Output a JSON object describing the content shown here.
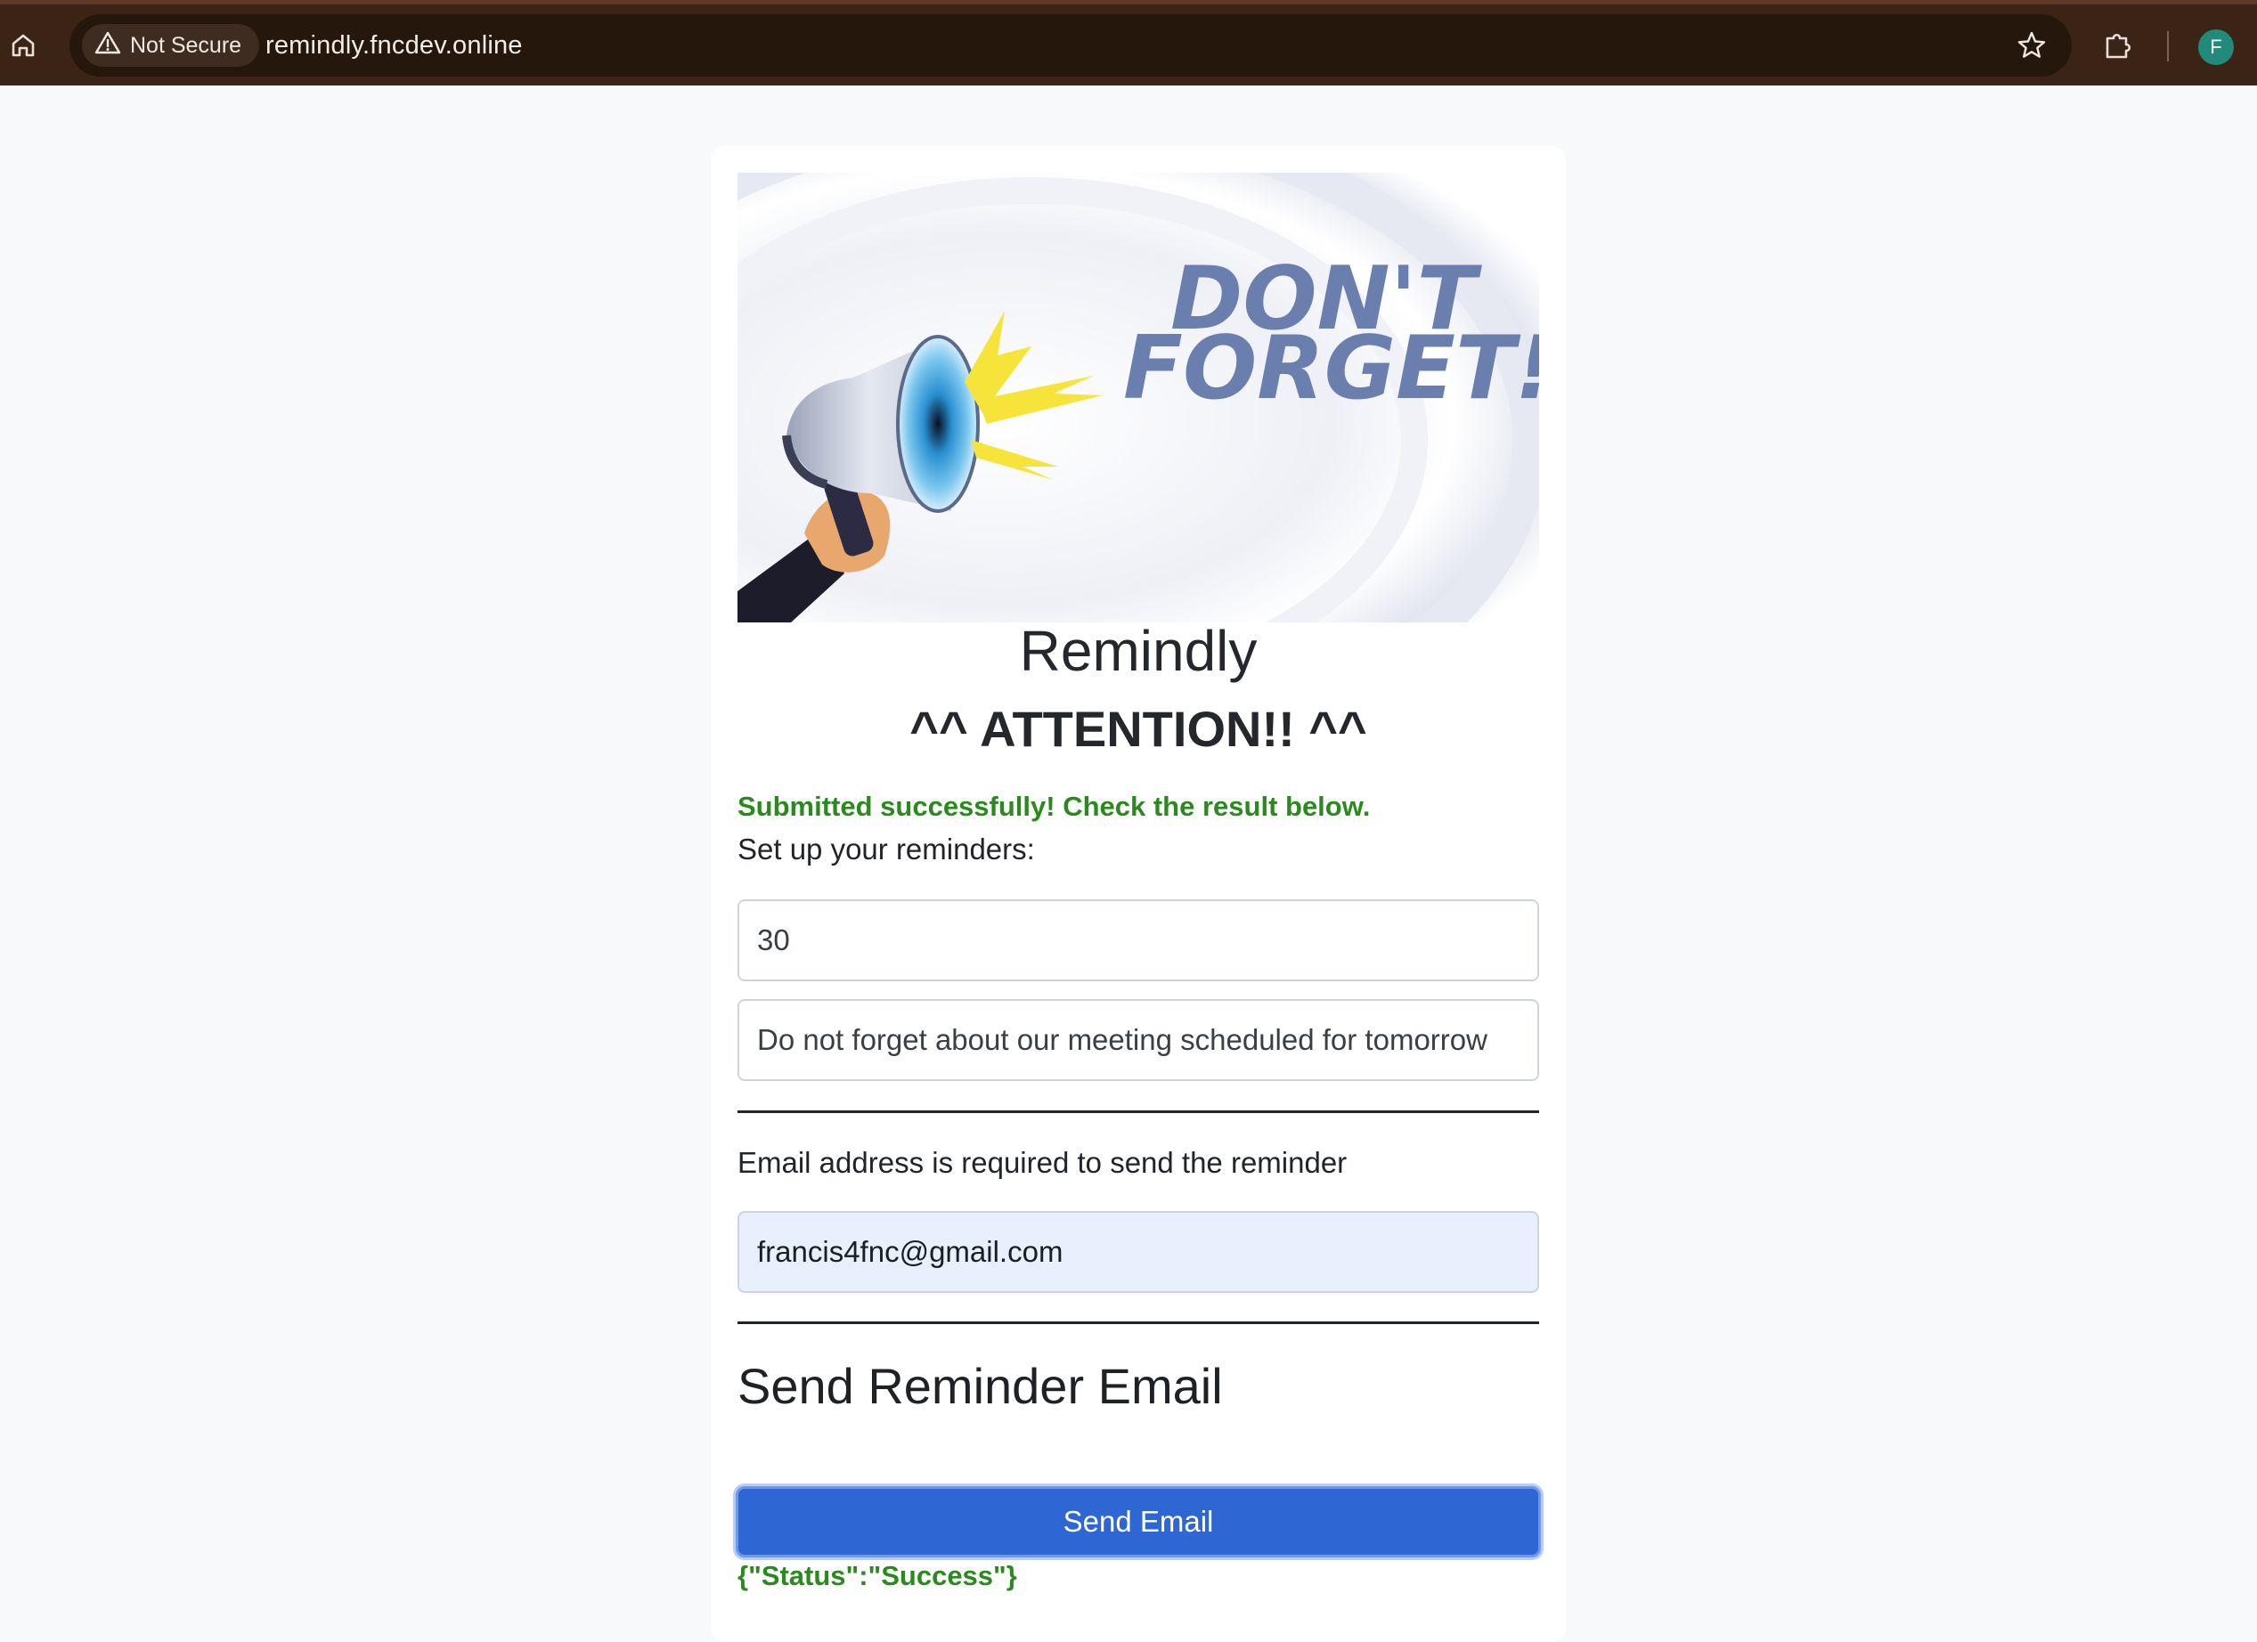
{
  "browser": {
    "security_label": "Not Secure",
    "url": "remindly.fncdev.online",
    "profile_initial": "F"
  },
  "hero": {
    "line1": "DON'T",
    "line2": "FORGET!"
  },
  "app": {
    "title": "Remindly",
    "attention": "^^ ATTENTION!! ^^",
    "success_message": "Submitted successfully! Check the result below.",
    "setup_label": "Set up your reminders:"
  },
  "form": {
    "minutes_value": "30",
    "message_value": "Do not forget about our meeting scheduled for tomorrow",
    "email_label": "Email address is required to send the reminder",
    "email_value": "francis4fnc@gmail.com",
    "section_heading": "Send Reminder Email",
    "send_button_label": "Send Email",
    "result_text": "{\"Status\":\"Success\"}"
  }
}
